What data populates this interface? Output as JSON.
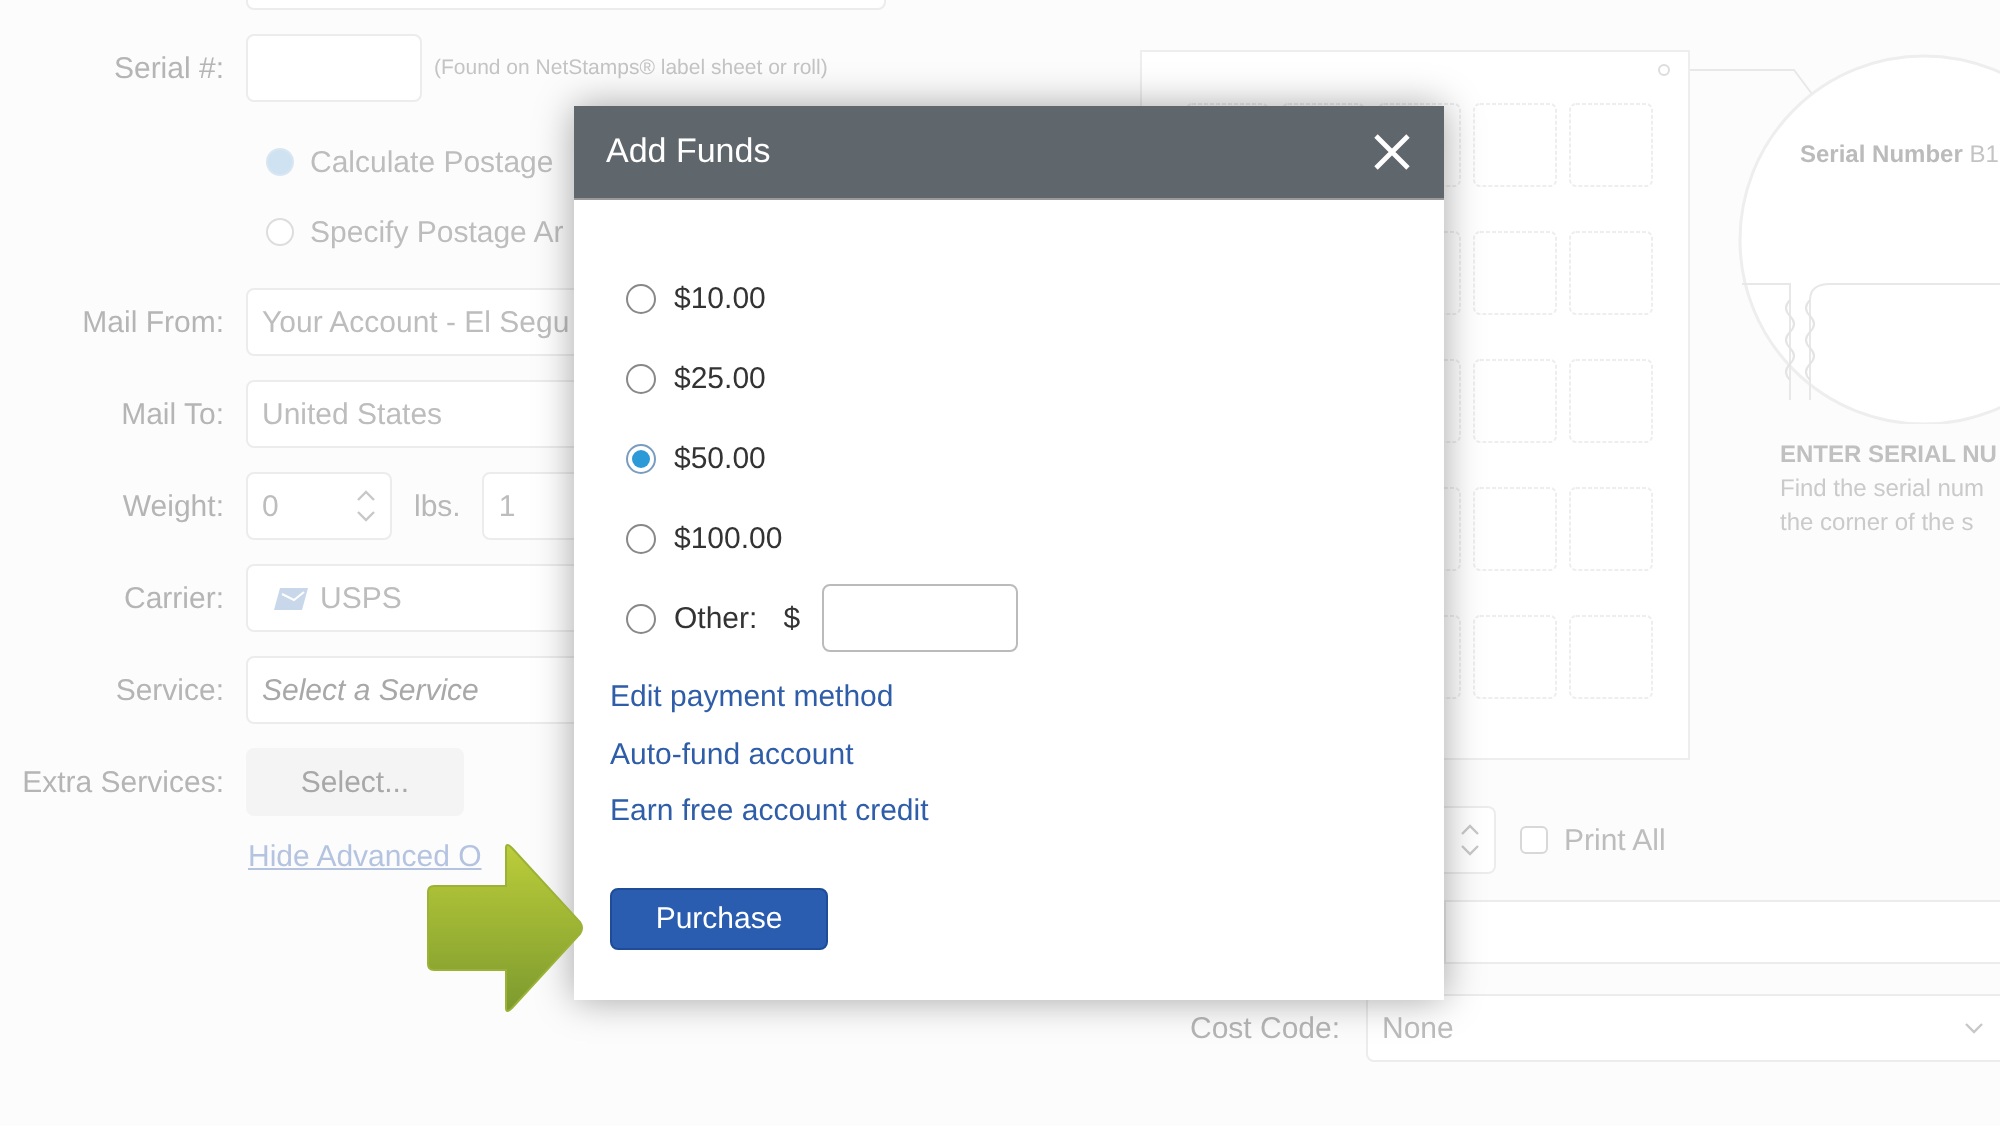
{
  "background_form": {
    "serial": {
      "label": "Serial #:",
      "hint": "(Found on NetStamps® label sheet or roll)"
    },
    "postage_options": [
      {
        "label": "Calculate Postage",
        "selected": true
      },
      {
        "label": "Specify Postage Ar",
        "selected": false
      }
    ],
    "fields": [
      {
        "label": "Mail From:",
        "kind": "text",
        "value": "Your Account - El Segu"
      },
      {
        "label": "Mail To:",
        "kind": "text",
        "value": "United States"
      },
      {
        "label": "Weight:",
        "kind": "weight",
        "value": "0",
        "unit": "lbs.",
        "value_2": "1"
      },
      {
        "label": "Carrier:",
        "kind": "carrier",
        "value": "USPS"
      },
      {
        "label": "Service:",
        "kind": "select",
        "placeholder": "Select a Service"
      },
      {
        "label": "Extra Services:",
        "kind": "button",
        "value": "Select..."
      }
    ],
    "advanced_link": "Hide Advanced O"
  },
  "serial_illustration": {
    "callout": "**Serial Number** B1",
    "heading": "ENTER SERIAL NU",
    "lines": [
      "Find the serial num",
      "the corner of the s"
    ]
  },
  "print_all": {
    "label": "Print All",
    "checked": false
  },
  "cost_code": {
    "label": "Cost Code:",
    "value": "None"
  },
  "dialog": {
    "title": "Add Funds",
    "amounts": [
      {
        "label": "$10.00",
        "kind": "amount",
        "selected": false
      },
      {
        "label": "$25.00",
        "kind": "amount",
        "selected": false
      },
      {
        "label": "$50.00",
        "kind": "amount",
        "selected": true
      },
      {
        "label": "$100.00",
        "kind": "amount",
        "selected": false
      },
      {
        "label": "Other:",
        "kind": "other",
        "currency": "$",
        "selected": false
      }
    ],
    "links": [
      "Edit payment method",
      "Auto-fund account",
      "Earn free account credit"
    ],
    "button": "Purchase"
  }
}
